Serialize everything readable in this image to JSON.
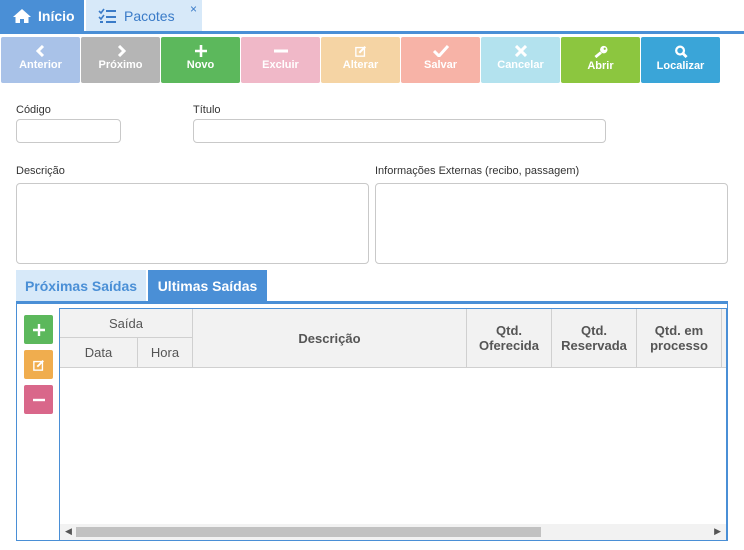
{
  "tabs": [
    {
      "label": "Início",
      "icon": "home-icon",
      "active": false
    },
    {
      "label": "Pacotes",
      "icon": "list-icon",
      "active": true,
      "close": "×"
    }
  ],
  "toolbar": [
    {
      "label": "Anterior",
      "icon": "chevron-left-icon",
      "color": "#a9c2e8"
    },
    {
      "label": "Próximo",
      "icon": "chevron-right-icon",
      "color": "#b5b5b5"
    },
    {
      "label": "Novo",
      "icon": "plus-icon",
      "color": "#5cb85c"
    },
    {
      "label": "Excluir",
      "icon": "minus-icon",
      "color": "#f0b8c8"
    },
    {
      "label": "Alterar",
      "icon": "edit-icon",
      "color": "#f5d4a4"
    },
    {
      "label": "Salvar",
      "icon": "check-icon",
      "color": "#f7b3a7"
    },
    {
      "label": "Cancelar",
      "icon": "close-icon",
      "color": "#b3e2ee"
    },
    {
      "label": "Abrir",
      "icon": "key-icon",
      "color": "#8cc63f"
    },
    {
      "label": "Localizar",
      "icon": "search-icon",
      "color": "#3aa5d8"
    }
  ],
  "form": {
    "codigo_label": "Código",
    "codigo_value": "",
    "titulo_label": "Título",
    "titulo_value": "",
    "descricao_label": "Descrição",
    "descricao_value": "",
    "info_label": "Informações Externas (recibo, passagem)",
    "info_value": ""
  },
  "subtabs": [
    {
      "label": "Próximas Saídas",
      "active": false
    },
    {
      "label": "Ultimas Saídas",
      "active": true
    }
  ],
  "side_buttons": [
    {
      "icon": "plus-icon",
      "color": "#5cb85c"
    },
    {
      "icon": "edit-icon",
      "color": "#f0ad4e"
    },
    {
      "icon": "minus-icon",
      "color": "#d9678a"
    }
  ],
  "grid": {
    "group_header": "Saída",
    "columns": [
      "Data",
      "Hora",
      "Descrição",
      "Qtd. Oferecida",
      "Qtd. Reservada",
      "Qtd. em processo"
    ],
    "rows": []
  }
}
